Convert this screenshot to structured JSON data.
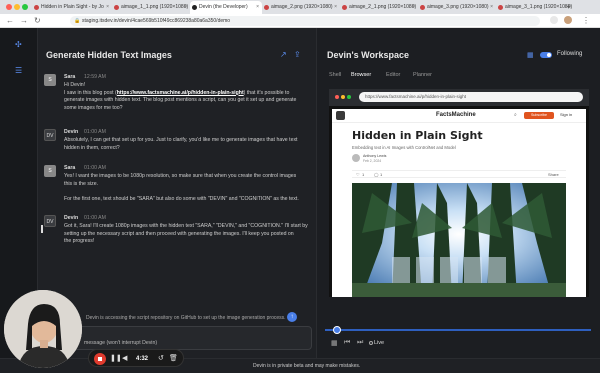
{
  "browser": {
    "tabs": [
      {
        "label": "Hidden in Plain Sight - by Jo",
        "active": false
      },
      {
        "label": "aimage_1_1.png (1920×1080)",
        "active": false
      },
      {
        "label": "Devin (the Developer)",
        "active": true
      },
      {
        "label": "aimage_2.png (1920×1080)",
        "active": false
      },
      {
        "label": "aimage_2_1.png (1920×1080)",
        "active": false
      },
      {
        "label": "aimage_3.png (1920×1080)",
        "active": false
      },
      {
        "label": "aimage_3_1.png (1920×1080)",
        "active": false
      }
    ],
    "url": "staging.itsdev.in/devin/4cae569b510f49cc869238a80a6a350/demo"
  },
  "chat": {
    "title": "Generate Hidden Text Images",
    "messages": [
      {
        "author": "Sara",
        "time": "12:59 AM",
        "avatar": "S",
        "lines": [
          "Hi Devin!",
          "I saw in this blog post (|https://www.factsmachine.ai/p/hidden-in-plain-sight|) that it's possible to",
          "generate images with hidden text. The blog post mentions a script, can you get it set up and generate",
          "some images for me too?"
        ]
      },
      {
        "author": "Devin",
        "time": "01:00 AM",
        "avatar": "DV",
        "lines": [
          "Absolutely, I can get that set up for you. Just to clarify, you'd like me to generate images that have text",
          "hidden in them, correct?"
        ]
      },
      {
        "author": "Sara",
        "time": "01:00 AM",
        "avatar": "S",
        "lines": [
          "Yes! I want the images to be 1080p resolution, so make sure that when you create the control images",
          "this is the size.",
          "",
          "For the first one, text should be \"SARA\" but also do some with \"DEVIN\" and \"COGNITION\" as the text."
        ]
      },
      {
        "author": "Devin",
        "time": "01:00 AM",
        "avatar": "DV",
        "lines": [
          "Got it, Sara! I'll create 1080p images with the hidden text \"SARA,\" \"DEVIN,\" and \"COGNITION.\" I'll start by",
          "setting up the necessary script and then proceed with generating the images. I'll keep you posted on",
          "the progress!"
        ]
      }
    ],
    "status": "Devin is accessing the script repository on GitHub to set up the image generation process.",
    "input_placeholder": "message (won't interrupt Devin)"
  },
  "workspace": {
    "title": "Devin's Workspace",
    "following_label": "Following",
    "tabs": [
      "Shell",
      "Browser",
      "Editor",
      "Planner"
    ],
    "active_tab": "Browser",
    "browser_url": "https://www.factsmachine.ai/p/hidden-in-plain-sight",
    "page": {
      "site_name": "FactsMachine",
      "subscribe": "Subscribe",
      "sign_in": "Sign in",
      "title": "Hidden in Plain Sight",
      "subtitle": "Embedding text in AI Images with ControlNet and Model",
      "author": "Anthony Lewis",
      "date": "Feb 2, 2024",
      "likes": "1",
      "comments": "1",
      "share": "Share"
    },
    "live_label": "Live",
    "follow_on": true
  },
  "footer": "Devin is in private beta and may make mistakes.",
  "recorder": {
    "time": "4:32"
  },
  "colors": {
    "accent": "#4a7fe8",
    "record": "#e03b2e",
    "subscribe": "#e0541f"
  }
}
